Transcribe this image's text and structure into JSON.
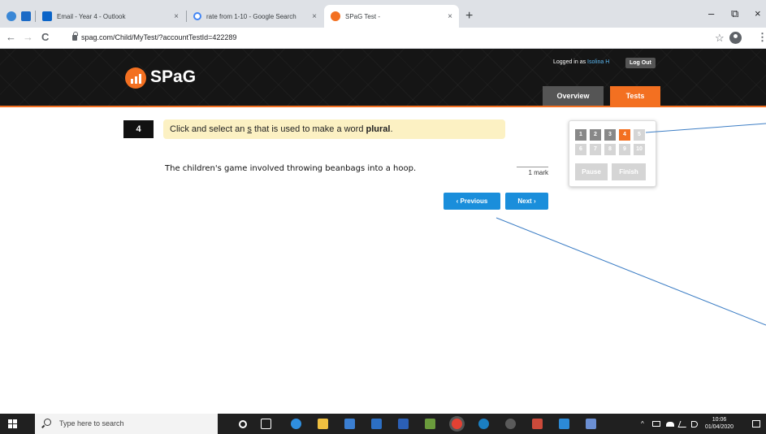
{
  "browser": {
    "tabs": [
      {
        "title": "",
        "favicon_color": "#1b6ac6"
      },
      {
        "title": "Email - Year 4 - Outlook",
        "favicon_color": "#0a64c8"
      },
      {
        "title": "rate from 1-10 - Google Search",
        "favicon_color": "#4285f4"
      },
      {
        "title": "SPaG Test -",
        "favicon_color": "#f37021"
      }
    ],
    "tab_close": "×",
    "new_tab": "+",
    "window_controls": {
      "minimize": "–",
      "maximize": "⧉",
      "close": "×"
    },
    "nav": {
      "back": "←",
      "forward": "→",
      "reload": "C"
    },
    "url": "spag.com/Child/MyTest/?accountTestId=422289",
    "star": "☆",
    "menu": "⋮"
  },
  "site": {
    "logo_text": "SPaG",
    "logged_in_prefix": "Logged in as",
    "user_name": "Isolina H",
    "logout_label": "Log Out",
    "nav_tabs": [
      {
        "label": "Overview",
        "color": "#555555"
      },
      {
        "label": "Tests",
        "color": "#f37021"
      }
    ],
    "accent_color": "#f37021"
  },
  "question": {
    "number": "4",
    "prompt_before": "Click and select an ",
    "prompt_s": "s",
    "prompt_middle": " that is used to make a word ",
    "prompt_bold": "plural",
    "prompt_end": ".",
    "sentence": "The children's game involved throwing beanbags into a hoop.",
    "marks": "1 mark",
    "previous_label": "‹ Previous",
    "next_label": "Next ›"
  },
  "navigator": {
    "row1": [
      {
        "label": "1",
        "state": "done"
      },
      {
        "label": "2",
        "state": "done"
      },
      {
        "label": "3",
        "state": "done"
      },
      {
        "label": "4",
        "state": "cur"
      },
      {
        "label": "5",
        "state": "todo"
      }
    ],
    "row2": [
      {
        "label": "6",
        "state": "todo"
      },
      {
        "label": "7",
        "state": "todo"
      },
      {
        "label": "8",
        "state": "todo"
      },
      {
        "label": "9",
        "state": "todo"
      },
      {
        "label": "10",
        "state": "todo"
      }
    ],
    "pause_label": "Pause",
    "finish_label": "Finish"
  },
  "taskbar": {
    "search_placeholder": "Type here to search",
    "tray_chevron": "^",
    "time": "10:06",
    "date": "01/04/2020"
  }
}
